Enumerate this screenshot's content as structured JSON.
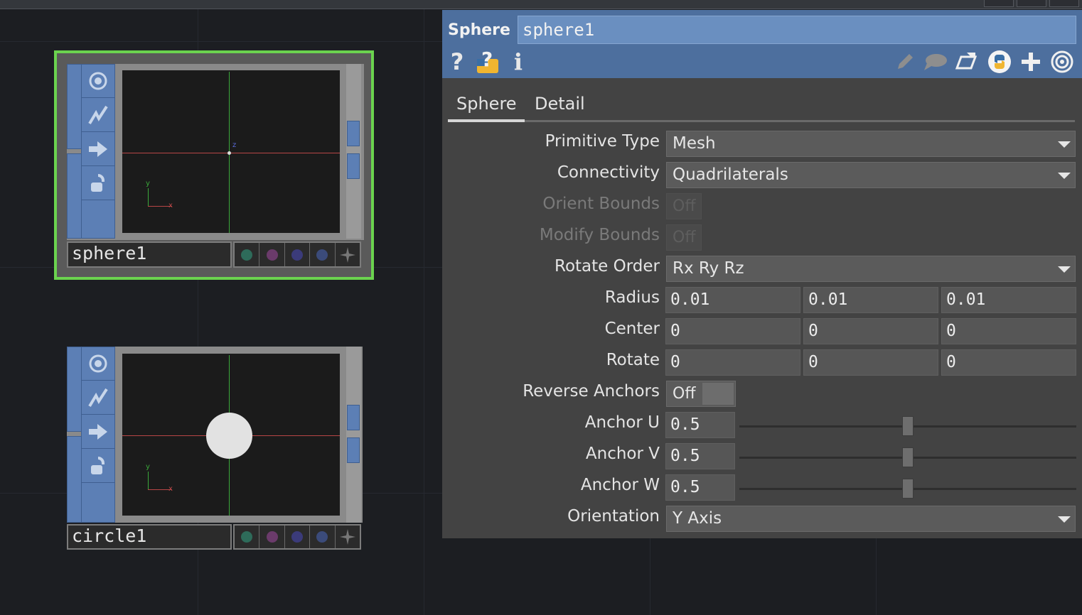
{
  "nodes": [
    {
      "name": "sphere1",
      "selected": true,
      "viewer_axes": {
        "x": "x",
        "y": "y",
        "z": "z"
      },
      "flag_icons": [
        "viewer-flag-icon",
        "cooking-flag-icon",
        "export-flag-icon",
        "lock-flag-icon"
      ],
      "shows_circle": false
    },
    {
      "name": "circle1",
      "selected": false,
      "viewer_axes": {
        "x": "x",
        "y": "y",
        "z": ""
      },
      "flag_icons": [
        "viewer-flag-icon",
        "cooking-flag-icon",
        "export-flag-icon",
        "lock-flag-icon"
      ],
      "shows_circle": true
    }
  ],
  "status_dot_colors": [
    "#2e6b5a",
    "#6b3b6b",
    "#3b3b7a",
    "#3b4b7a"
  ],
  "panel": {
    "op_type": "Sphere",
    "op_name": "sphere1",
    "header_icons_left": [
      "help-icon",
      "python-help-icon",
      "info-icon"
    ],
    "header_icons_right": [
      "edit-icon",
      "comment-icon",
      "clone-icon",
      "python-icon",
      "add-icon",
      "viewer-icon"
    ],
    "tabs": [
      "Sphere",
      "Detail"
    ],
    "active_tab": "Sphere",
    "params": {
      "primitive_type": {
        "label": "Primitive Type",
        "value": "Mesh"
      },
      "connectivity": {
        "label": "Connectivity",
        "value": "Quadrilaterals"
      },
      "orient_bounds": {
        "label": "Orient Bounds",
        "value": "Off"
      },
      "modify_bounds": {
        "label": "Modify Bounds",
        "value": "Off"
      },
      "rotate_order": {
        "label": "Rotate Order",
        "value": "Rx Ry Rz"
      },
      "radius": {
        "label": "Radius",
        "values": [
          "0.01",
          "0.01",
          "0.01"
        ]
      },
      "center": {
        "label": "Center",
        "values": [
          "0",
          "0",
          "0"
        ]
      },
      "rotate": {
        "label": "Rotate",
        "values": [
          "0",
          "0",
          "0"
        ]
      },
      "reverse_anchors": {
        "label": "Reverse Anchors",
        "value": "Off"
      },
      "anchor_u": {
        "label": "Anchor U",
        "value": "0.5",
        "slider_fraction": 0.5
      },
      "anchor_v": {
        "label": "Anchor V",
        "value": "0.5",
        "slider_fraction": 0.5
      },
      "anchor_w": {
        "label": "Anchor W",
        "value": "0.5",
        "slider_fraction": 0.5
      },
      "orientation": {
        "label": "Orientation",
        "value": "Y Axis"
      }
    }
  }
}
